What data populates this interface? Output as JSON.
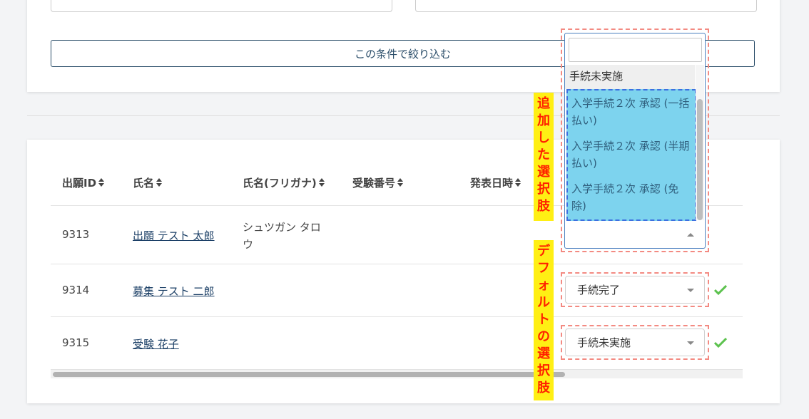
{
  "filter": {
    "submit_label": "この条件で絞り込む"
  },
  "table": {
    "columns": [
      "出願ID",
      "氏名",
      "氏名(フリガナ)",
      "受験番号",
      "発表日時"
    ],
    "rows": [
      {
        "id": "9313",
        "name": "出願 テスト 太郎",
        "kana": "シュツガン タロウ",
        "exam_no": "",
        "announce": ""
      },
      {
        "id": "9314",
        "name": "募集 テスト 二郎",
        "kana": "",
        "exam_no": "",
        "announce": "",
        "status": "手続完了"
      },
      {
        "id": "9315",
        "name": "受験 花子",
        "kana": "",
        "exam_no": "",
        "announce": "",
        "status": "手続未実施"
      }
    ]
  },
  "dropdown": {
    "search_value": "",
    "options": [
      "手続未実施"
    ],
    "added_options": [
      "入学手続２次 承認 (一括払い)",
      "入学手続２次 承認 (半期払い)",
      "入学手続２次 承認 (免除)"
    ]
  },
  "annotations": {
    "added_label": "追加した選択肢",
    "default_label": "デフォルトの選択肢"
  },
  "icons": {
    "check": "check-icon",
    "check_color": "#5cc24e",
    "caret": "caret-down-icon"
  }
}
